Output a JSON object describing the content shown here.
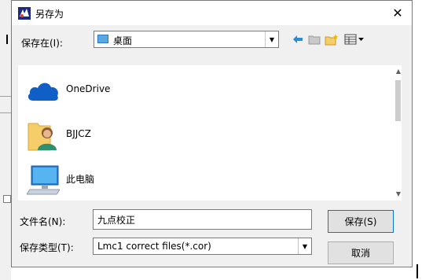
{
  "window": {
    "title": "另存为",
    "close_glyph": "✕"
  },
  "save_in": {
    "label": "保存在(I):",
    "value": "桌面"
  },
  "toolbar": {
    "back_icon": "back-arrow-icon",
    "up_icon": "up-folder-icon",
    "new_folder_icon": "new-folder-icon",
    "view_menu_icon": "view-menu-icon"
  },
  "file_list": {
    "items": [
      {
        "label": "OneDrive",
        "icon": "onedrive-cloud-icon"
      },
      {
        "label": "BJJCZ",
        "icon": "user-folder-icon"
      },
      {
        "label": "此电脑",
        "icon": "computer-icon"
      }
    ]
  },
  "filename": {
    "label": "文件名(N):",
    "value": "九点校正"
  },
  "filetype": {
    "label": "保存类型(T):",
    "value": "Lmc1 correct files(*.cor)"
  },
  "buttons": {
    "save": "保存(S)",
    "cancel": "取消"
  },
  "colors": {
    "accent": "#0078d7",
    "onedrive": "#0f5fc7",
    "folder": "#f5cd6b"
  }
}
